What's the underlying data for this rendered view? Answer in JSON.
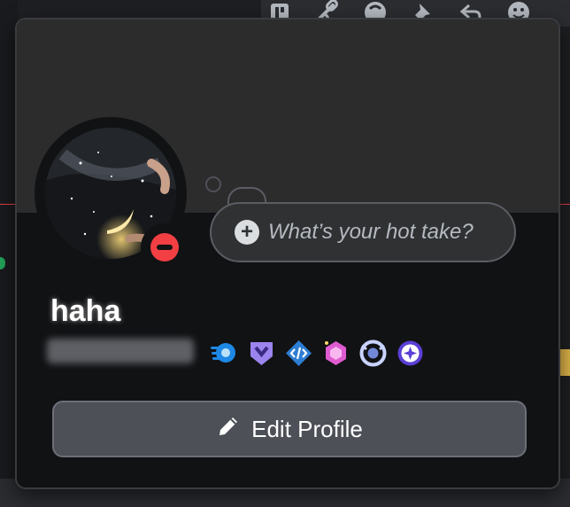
{
  "profile": {
    "display_name": "haha",
    "status": "Do Not Disturb",
    "custom_status_placeholder": "What’s your hot take?",
    "edit_profile_label": "Edit Profile",
    "badges": [
      "nitro-badge",
      "hypesquad-badge",
      "active-developer-badge",
      "server-boost-badge",
      "quest-badge",
      "orbs-badge"
    ]
  },
  "toolbar_icons": [
    "threads-icon",
    "link-icon",
    "mute-icon",
    "pin-icon",
    "reply-icon",
    "emoji-icon"
  ],
  "colors": {
    "banner": "#2c2c2c",
    "card": "#111214",
    "dnd": "#f23f43",
    "button": "#4e5058"
  }
}
